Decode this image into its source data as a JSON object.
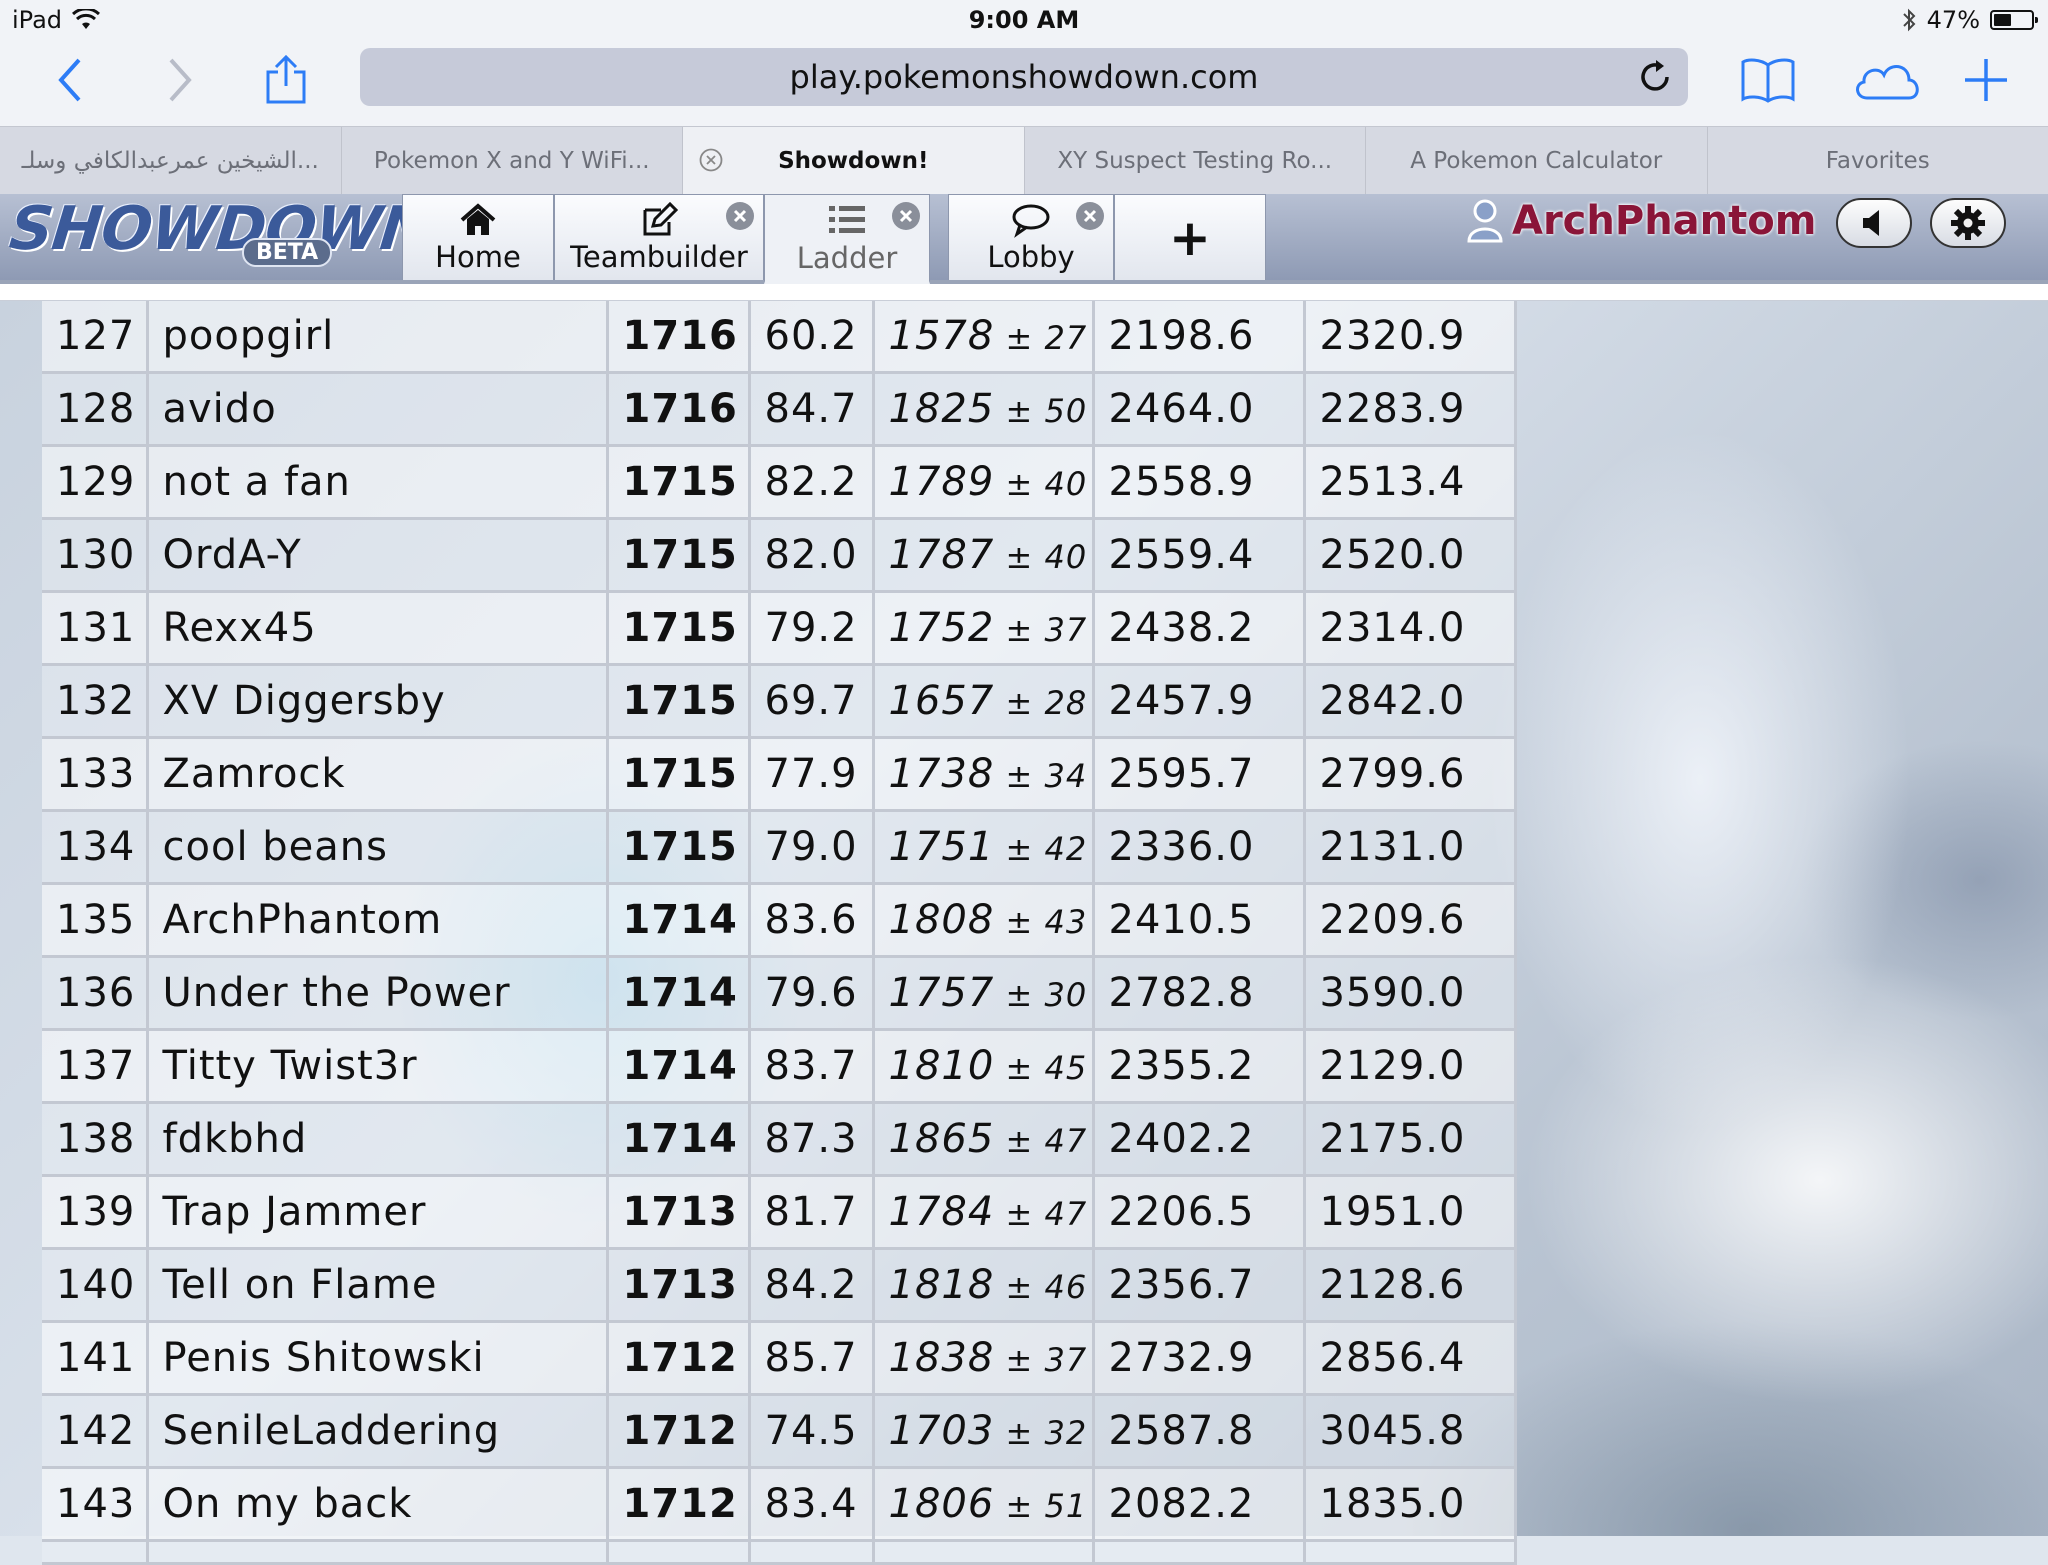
{
  "status_bar": {
    "device": "iPad",
    "time": "9:00 AM",
    "battery_percent": "47%",
    "battery_level": 0.47
  },
  "toolbar": {
    "url": "play.pokemonshowdown.com"
  },
  "tabs": [
    {
      "label": "الشيخين عمرعبدالكافي وسلـ..."
    },
    {
      "label": "Pokemon X and Y WiFi..."
    },
    {
      "label": "Showdown!"
    },
    {
      "label": "XY Suspect Testing Ro..."
    },
    {
      "label": "A Pokemon Calculator"
    },
    {
      "label": "Favorites"
    }
  ],
  "showdown": {
    "logo_text": "SHOWDOWN",
    "beta_label": "BETA",
    "nav": {
      "home": "Home",
      "teambuilder": "Teambuilder",
      "ladder": "Ladder",
      "lobby": "Lobby",
      "new_tab": "+"
    },
    "username": "ArchPhantom"
  },
  "ladder": {
    "rows": [
      {
        "rank": "127",
        "name": "poopgirl",
        "elo": "1716",
        "gxe": "60.2",
        "glicko": "1578",
        "dev": "27",
        "col5": "2198.6",
        "col6": "2320.9"
      },
      {
        "rank": "128",
        "name": "avido",
        "elo": "1716",
        "gxe": "84.7",
        "glicko": "1825",
        "dev": "50",
        "col5": "2464.0",
        "col6": "2283.9"
      },
      {
        "rank": "129",
        "name": "not a fan",
        "elo": "1715",
        "gxe": "82.2",
        "glicko": "1789",
        "dev": "40",
        "col5": "2558.9",
        "col6": "2513.4"
      },
      {
        "rank": "130",
        "name": "OrdA-Y",
        "elo": "1715",
        "gxe": "82.0",
        "glicko": "1787",
        "dev": "40",
        "col5": "2559.4",
        "col6": "2520.0"
      },
      {
        "rank": "131",
        "name": "Rexx45",
        "elo": "1715",
        "gxe": "79.2",
        "glicko": "1752",
        "dev": "37",
        "col5": "2438.2",
        "col6": "2314.0"
      },
      {
        "rank": "132",
        "name": "XV Diggersby",
        "elo": "1715",
        "gxe": "69.7",
        "glicko": "1657",
        "dev": "28",
        "col5": "2457.9",
        "col6": "2842.0"
      },
      {
        "rank": "133",
        "name": "Zamrock",
        "elo": "1715",
        "gxe": "77.9",
        "glicko": "1738",
        "dev": "34",
        "col5": "2595.7",
        "col6": "2799.6"
      },
      {
        "rank": "134",
        "name": "cool beans",
        "elo": "1715",
        "gxe": "79.0",
        "glicko": "1751",
        "dev": "42",
        "col5": "2336.0",
        "col6": "2131.0"
      },
      {
        "rank": "135",
        "name": "ArchPhantom",
        "elo": "1714",
        "gxe": "83.6",
        "glicko": "1808",
        "dev": "43",
        "col5": "2410.5",
        "col6": "2209.6"
      },
      {
        "rank": "136",
        "name": "Under the Power",
        "elo": "1714",
        "gxe": "79.6",
        "glicko": "1757",
        "dev": "30",
        "col5": "2782.8",
        "col6": "3590.0"
      },
      {
        "rank": "137",
        "name": "Titty Twist3r",
        "elo": "1714",
        "gxe": "83.7",
        "glicko": "1810",
        "dev": "45",
        "col5": "2355.2",
        "col6": "2129.0"
      },
      {
        "rank": "138",
        "name": "fdkbhd",
        "elo": "1714",
        "gxe": "87.3",
        "glicko": "1865",
        "dev": "47",
        "col5": "2402.2",
        "col6": "2175.0"
      },
      {
        "rank": "139",
        "name": "Trap Jammer",
        "elo": "1713",
        "gxe": "81.7",
        "glicko": "1784",
        "dev": "47",
        "col5": "2206.5",
        "col6": "1951.0"
      },
      {
        "rank": "140",
        "name": "Tell on Flame",
        "elo": "1713",
        "gxe": "84.2",
        "glicko": "1818",
        "dev": "46",
        "col5": "2356.7",
        "col6": "2128.6"
      },
      {
        "rank": "141",
        "name": "Penis Shitowski",
        "elo": "1712",
        "gxe": "85.7",
        "glicko": "1838",
        "dev": "37",
        "col5": "2732.9",
        "col6": "2856.4"
      },
      {
        "rank": "142",
        "name": "SenileLaddering",
        "elo": "1712",
        "gxe": "74.5",
        "glicko": "1703",
        "dev": "32",
        "col5": "2587.8",
        "col6": "3045.8"
      },
      {
        "rank": "143",
        "name": "On my back",
        "elo": "1712",
        "gxe": "83.4",
        "glicko": "1806",
        "dev": "51",
        "col5": "2082.2",
        "col6": "1835.0"
      }
    ]
  }
}
